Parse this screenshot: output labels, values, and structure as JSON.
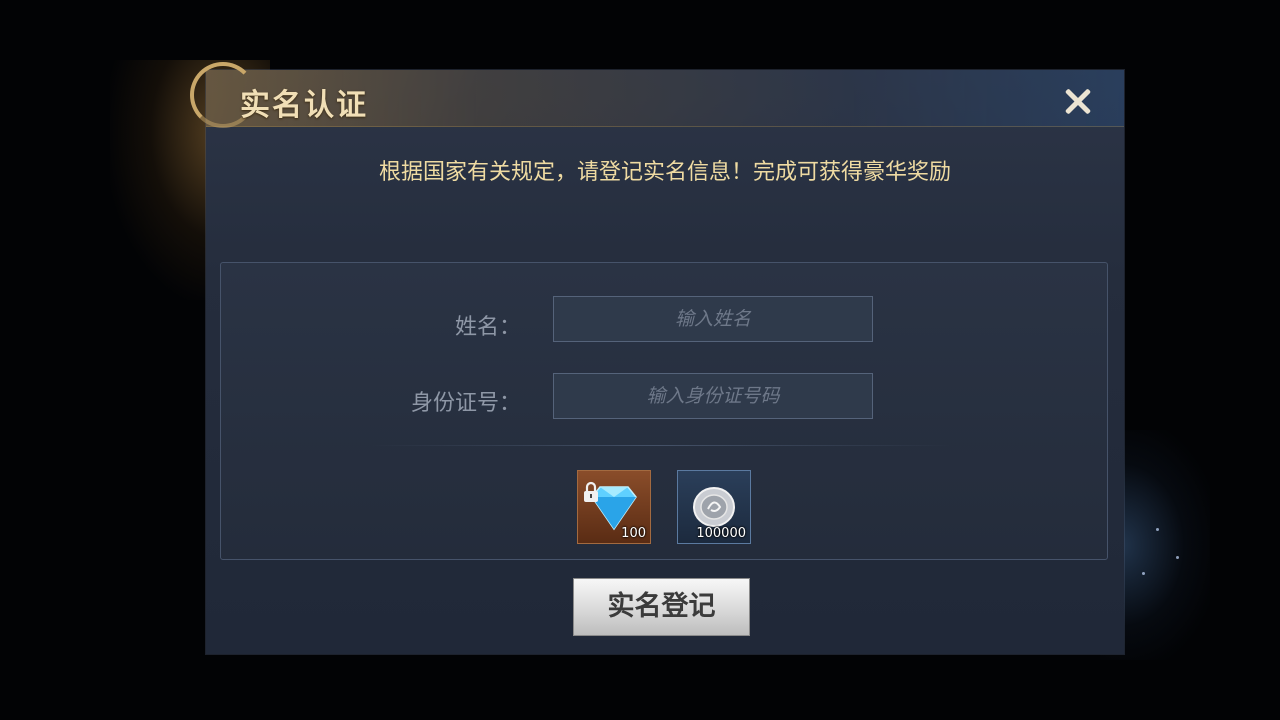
{
  "dialog": {
    "title": "实名认证",
    "notice": "根据国家有关规定，请登记实名信息！完成可获得豪华奖励"
  },
  "form": {
    "name_label": "姓名：",
    "name_placeholder": "输入姓名",
    "id_label": "身份证号：",
    "id_placeholder": "输入身份证号码"
  },
  "rewards": [
    {
      "icon": "locked-diamond-icon",
      "quantity": "100"
    },
    {
      "icon": "silver-coin-icon",
      "quantity": "100000"
    }
  ],
  "buttons": {
    "register_label": "实名登记",
    "close_icon": "close-icon"
  },
  "colors": {
    "notice_text": "#efdba2",
    "title_text": "#f1dfb6",
    "panel_bg": "#242c3b",
    "accent_gold": "#c9a769"
  }
}
